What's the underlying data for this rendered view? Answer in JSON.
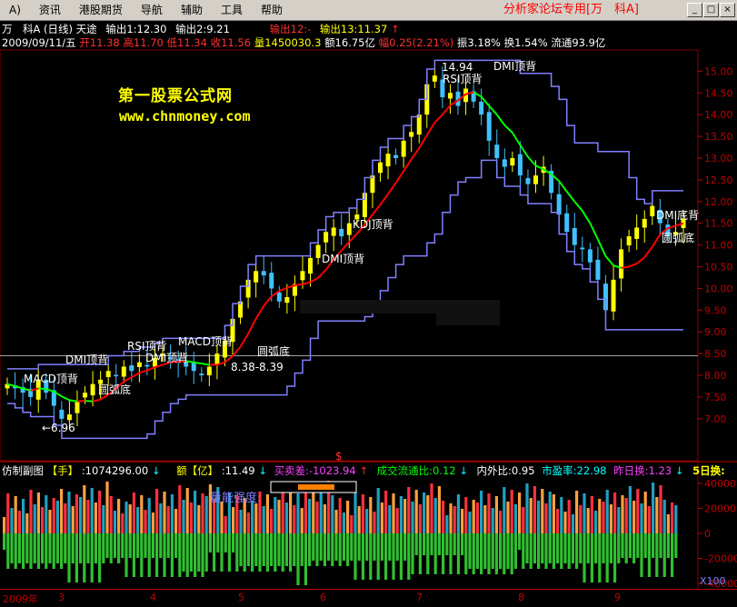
{
  "menu": {
    "indicator": "A)",
    "items": [
      "资讯",
      "港股期货",
      "导航",
      "辅助",
      "工具",
      "帮助"
    ],
    "title": "分析家论坛专用[万　科A]",
    "controls": [
      "_",
      "□",
      "×"
    ]
  },
  "header": {
    "stock": "万　科A",
    "period": "(日线)",
    "indicator_name": "天途",
    "out1": "输出1:12.30",
    "out2": "输出2:9.21",
    "out12": "输出12:-",
    "out13": "输出13:11.37",
    "up_arrow": "↑"
  },
  "quote": {
    "date": "2009/09/11/五",
    "open": "开11.38",
    "high": "高11.70",
    "low": "低11.34",
    "close": "收11.56",
    "volume": "量1450030.3",
    "amount": "额16.75亿",
    "change": "幅0.25(2.21%)",
    "amplitude": "振3.18%",
    "turnover": "换1.54%",
    "float": "流通93.9亿"
  },
  "watermark": {
    "name": "第一股票公式网",
    "url": "www.chnmoney.com"
  },
  "annotations": [
    {
      "text": "14.94"
    },
    {
      "text": "RSI顶背"
    },
    {
      "text": "DMI顶背"
    },
    {
      "text": "KDJ顶背"
    },
    {
      "text": "DMI顶背"
    },
    {
      "text": "RSI顶背"
    },
    {
      "text": "MACD顶背"
    },
    {
      "text": "DMI顶背"
    },
    {
      "text": "DMI顶背"
    },
    {
      "text": "圆弧底"
    },
    {
      "text": "8.38-8.39"
    },
    {
      "text": "MACD顶背"
    },
    {
      "text": "圆弧底"
    },
    {
      "text": "←6.96"
    },
    {
      "text": "DMI底背"
    },
    {
      "text": "圆弧底"
    }
  ],
  "price_axis": [
    "15.00",
    "14.50",
    "14.00",
    "13.50",
    "13.00",
    "12.50",
    "12.00",
    "11.50",
    "11.00",
    "10.50",
    "10.00",
    "9.50",
    "9.00",
    "8.50",
    "8.00",
    "7.50",
    "7.00"
  ],
  "sub": {
    "name": "仿制副图",
    "vol_label": "【手】",
    "vol_value": ":1074296.00",
    "amt_label": "额【亿】",
    "amt_value": ":11.49",
    "diff": "买卖差:-1023.94",
    "ratio": "成交流通比:0.12",
    "inout": "内外比:0.95",
    "pe": "市盈率:22.98",
    "prev_turn": "昨日换:1.23",
    "five_day": "5日换:",
    "inner_label": "量能强度:",
    "dollar": "$",
    "down_arrow": "↓",
    "up_arrow": "↑"
  },
  "sub_axis": [
    "40000",
    "20000",
    "0",
    "-20000",
    "-40000"
  ],
  "unit": "X100",
  "time_axis": [
    "2009年",
    "3",
    "4",
    "5",
    "6",
    "7",
    "8",
    "9"
  ],
  "colors": {
    "up": "#ff3030",
    "down": "#00ffff",
    "candle_up": "#ffff00",
    "candle_down": "#40c0ff",
    "channel": "#8080ff",
    "ma_red": "#ff0000",
    "ma_green": "#00ff00",
    "grid": "#800000",
    "axis_text": "#c00000"
  },
  "chart_data": {
    "type": "candlestick",
    "price_range": [
      6.6,
      15.3
    ],
    "highlight_price": 8.45,
    "closes": [
      7.8,
      7.7,
      7.6,
      7.5,
      7.9,
      7.6,
      7.3,
      7.0,
      7.1,
      7.4,
      7.6,
      7.8,
      7.9,
      8.1,
      8.0,
      8.2,
      8.1,
      8.3,
      8.2,
      8.4,
      8.5,
      8.4,
      8.3,
      8.2,
      8.1,
      8.0,
      8.2,
      8.5,
      8.8,
      9.3,
      9.7,
      10.2,
      10.4,
      10.3,
      10.0,
      9.7,
      9.8,
      10.1,
      10.4,
      10.7,
      11.0,
      11.3,
      11.4,
      11.2,
      11.5,
      11.7,
      12.2,
      12.6,
      12.9,
      13.1,
      13.0,
      13.4,
      13.6,
      14.0,
      14.7,
      14.9,
      14.4,
      14.5,
      14.2,
      14.6,
      14.3,
      14.0,
      13.4,
      13.0,
      12.8,
      13.0,
      12.6,
      12.4,
      12.6,
      12.8,
      12.2,
      11.7,
      11.3,
      11.0,
      10.9,
      10.6,
      10.2,
      9.5,
      10.2,
      10.9,
      11.2,
      11.4,
      11.6,
      11.9,
      11.5,
      11.2,
      11.3,
      11.6
    ]
  }
}
